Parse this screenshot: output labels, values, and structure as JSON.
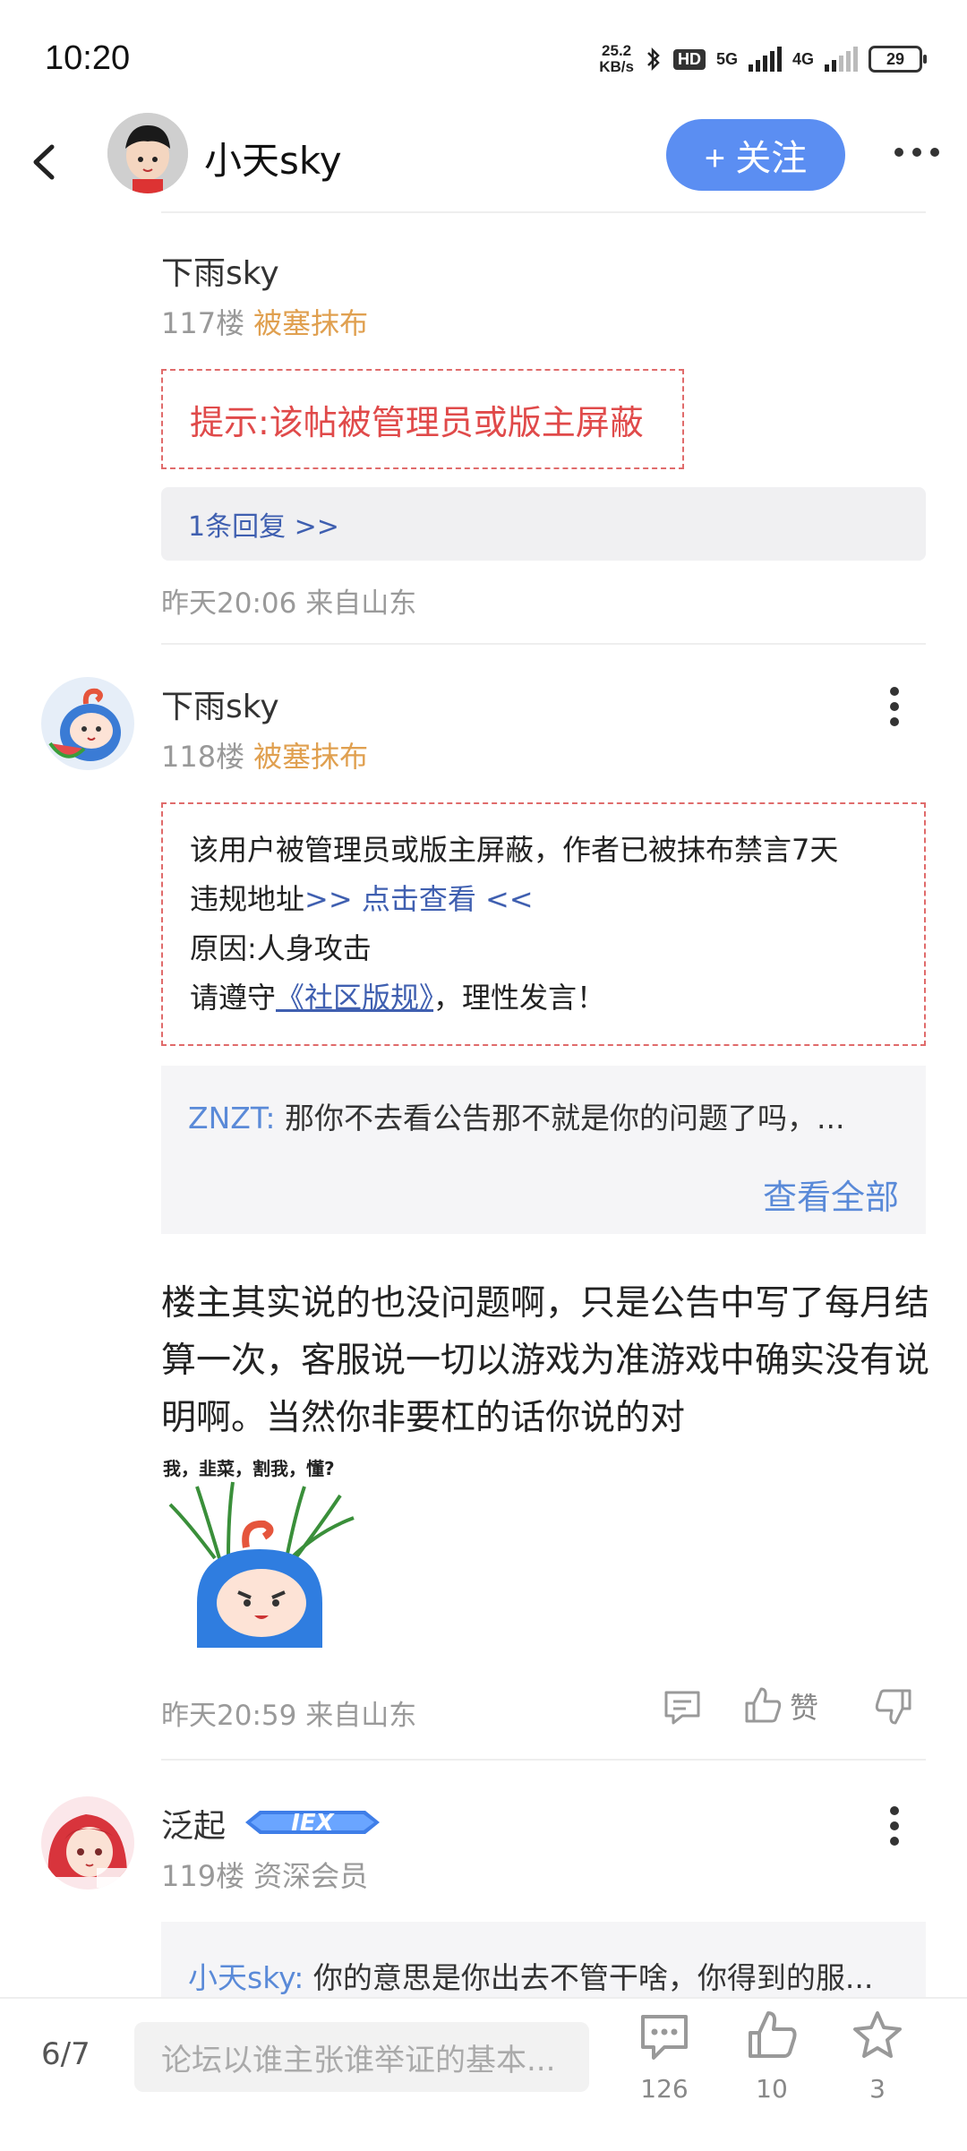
{
  "status": {
    "time": "10:20",
    "speed_top": "25.2",
    "speed_unit": "KB/s",
    "hd": "HD",
    "net1": "5G",
    "net2": "4G",
    "battery": "29"
  },
  "header": {
    "username": "小天sky",
    "follow_label": "+ 关注",
    "icons": [
      "back-icon",
      "more-icon"
    ]
  },
  "posts": [
    {
      "username": "下雨sky",
      "floor": "117楼",
      "tag": "被塞抹布",
      "notice": "提示:该帖被管理员或版主屏蔽",
      "replies_link": "1条回复 >>",
      "time": "昨天20:06 来自山东"
    },
    {
      "username": "下雨sky",
      "floor": "118楼",
      "tag": "被塞抹布",
      "ban_line1": "该用户被管理员或版主屏蔽，作者已被抹布禁言7天",
      "ban_line2_prefix": "违规地址",
      "ban_line2_link": ">> 点击查看 <<",
      "ban_line3": "原因:人身攻击",
      "ban_line4_prefix": "请遵守",
      "ban_line4_link": "《社区版规》",
      "ban_line4_suffix": "，理性发言！",
      "quote_user": "ZNZT:",
      "quote_text": " 那你不去看公告那不就是你的问题了吗，...",
      "quote_view_all": "查看全部",
      "content": "楼主其实说的也没问题啊，只是公告中写了每月结算一次，客服说一切以游戏为准游戏中确实没有说明啊。当然你非要杠的话你说的对",
      "sticker_caption": "我，韭菜，割我，懂?",
      "time": "昨天20:59 来自山东",
      "like_label": "赞"
    },
    {
      "username": "泛起",
      "floor": "119楼",
      "rank": "资深会员",
      "badge_text": "IEX",
      "quote_user": "小天sky:",
      "quote_text": " 你的意思是你出去不管干啥，你得到的服..."
    }
  ],
  "bottom": {
    "page": "6/7",
    "input_placeholder": "论坛以谁主张谁举证的基本...",
    "comments": "126",
    "likes": "10",
    "favorites": "3"
  }
}
